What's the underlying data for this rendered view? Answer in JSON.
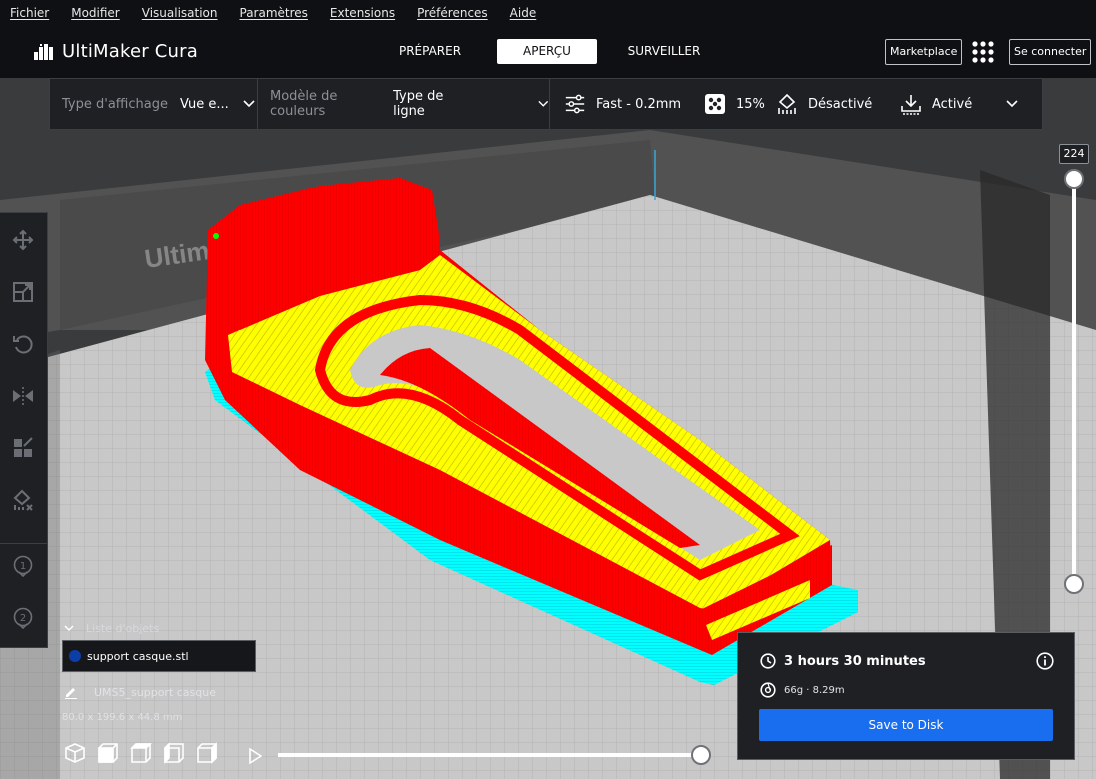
{
  "menubar": {
    "items": [
      {
        "label": "Fichier"
      },
      {
        "label": "Modifier"
      },
      {
        "label": "Visualisation"
      },
      {
        "label": "Paramètres"
      },
      {
        "label": "Extensions"
      },
      {
        "label": "Préférences"
      },
      {
        "label": "Aide"
      }
    ]
  },
  "header": {
    "app_name": "UltiMaker Cura",
    "stages": [
      "PRÉPARER",
      "APERÇU",
      "SURVEILLER"
    ],
    "active_stage": "APERÇU",
    "marketplace_label": "Marketplace",
    "signin_label": "Se connecter"
  },
  "view_settings": {
    "view_type_label": "Type d'affichage",
    "view_type_value": "Vue e...",
    "color_scheme_label": "Modèle de couleurs",
    "color_scheme_value": "Type de ligne"
  },
  "print_setup": {
    "profile": "Fast - 0.2mm",
    "infill": "15%",
    "support": "Désactivé",
    "adhesion": "Activé"
  },
  "layer_view": {
    "current_layer": "224"
  },
  "viewport": {
    "build_plate_text": "Ultim"
  },
  "objects": {
    "list_title": "Liste d'objets",
    "items": [
      {
        "name": "support casque.stl",
        "color": "#0d3ea8"
      }
    ],
    "job_name": "UMS5_support casque",
    "dimensions": "80.0 x 199.6 x 44.8 mm"
  },
  "print_info": {
    "time": "3 hours 30 minutes",
    "material": "66g · 8.29m",
    "save_label": "Save to Disk"
  },
  "colors": {
    "accent": "#196ef0",
    "wall_outer": "#ff0000",
    "wall_inner": "#00ff00",
    "skin": "#ffff00",
    "brim": "#00ffff",
    "build_plate": "#c9c9c9"
  },
  "icons": [
    "cura-logo-icon",
    "apps-grid-icon",
    "settings-sliders-icon",
    "infill-icon",
    "support-icon",
    "adhesion-icon",
    "move-icon",
    "scale-icon",
    "rotate-icon",
    "mirror-icon",
    "per-model-settings-icon",
    "support-blocker-icon",
    "extruder-1-icon",
    "extruder-2-icon",
    "clock-icon",
    "info-icon",
    "spool-icon",
    "pencil-icon",
    "camera-3d-icon",
    "camera-front-icon",
    "camera-top-icon",
    "camera-left-icon",
    "camera-right-icon",
    "play-icon"
  ]
}
